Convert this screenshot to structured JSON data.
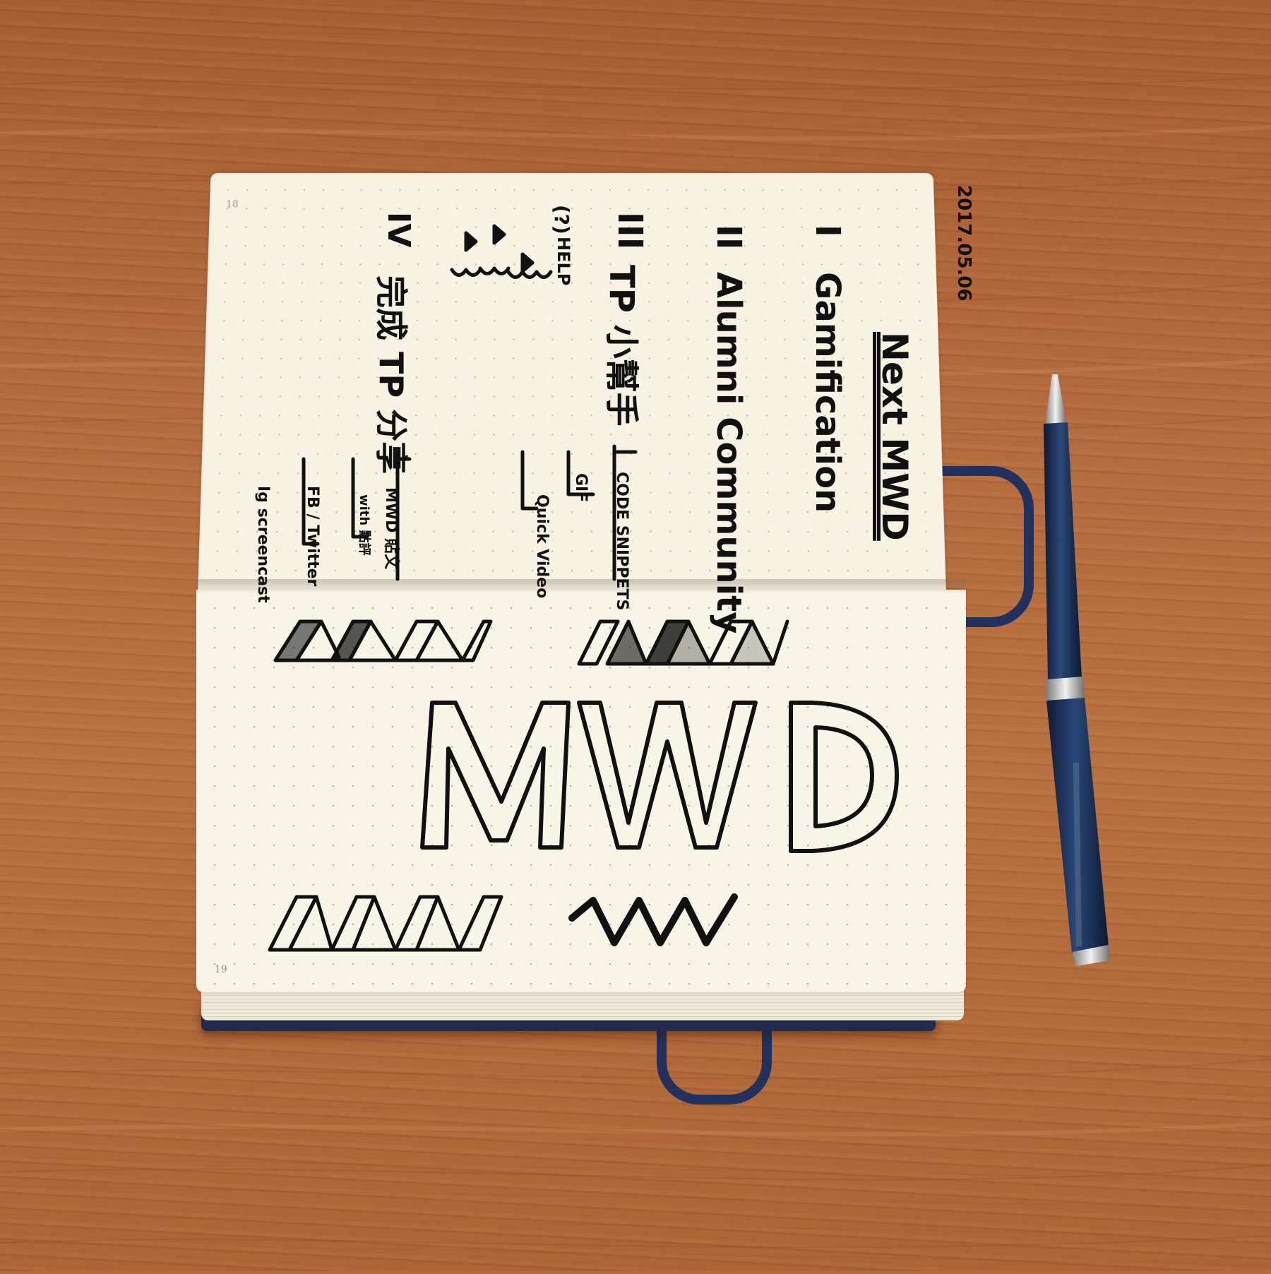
{
  "scene": {
    "colors": {
      "wood": "#b56b3e",
      "paper": "#f7f2e2",
      "ink": "#111111",
      "band": "#23315e",
      "pen_body": "#1d3157",
      "pen_metal": "#c9c9c9"
    },
    "page_top": {
      "page_number": "18",
      "date": "2017.05.06",
      "title": "Next MWD",
      "items": [
        {
          "numeral": "I",
          "text": "Gamification"
        },
        {
          "numeral": "II",
          "text": "Alumni Community"
        },
        {
          "numeral": "III",
          "text": "TP 小幫手"
        },
        {
          "numeral": "IV",
          "text": "完成 TP 分享"
        }
      ],
      "sub_items_3": [
        "CODE SNIPPETS",
        "GIF",
        "Quick Video"
      ],
      "sub_items_4": [
        "MWD 貼文",
        "with 點評",
        "FB / Twitter",
        "Ig screencast"
      ],
      "help_label": "HELP",
      "help_icon": "question-mark-icon"
    },
    "page_bottom": {
      "page_number": "19",
      "big_letters": "MWD"
    }
  }
}
